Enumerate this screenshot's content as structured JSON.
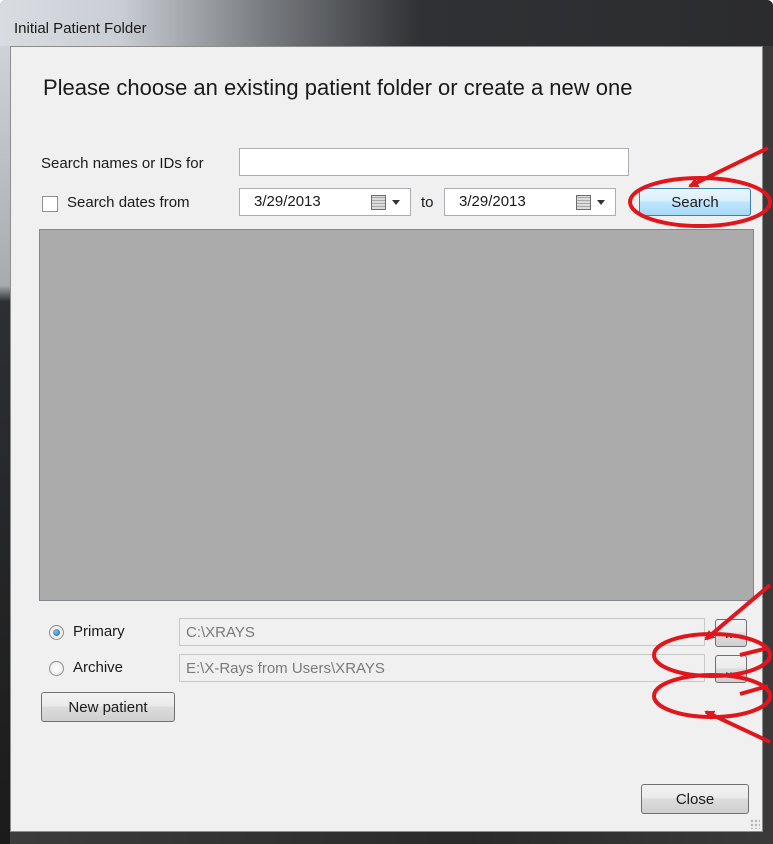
{
  "window": {
    "title": "Initial Patient Folder"
  },
  "heading": "Please choose an existing patient folder or create a new one",
  "search": {
    "names_label": "Search names or IDs for",
    "names_value": "",
    "dates_label": "Search dates from",
    "dates_checked": false,
    "date_from": "3/29/2013",
    "to_label": "to",
    "date_to": "3/29/2013",
    "search_button": "Search"
  },
  "results": {
    "rows": []
  },
  "locations": {
    "primary_label": "Primary",
    "primary_selected": true,
    "primary_path": "C:\\XRAYS",
    "archive_label": "Archive",
    "archive_selected": false,
    "archive_path": "E:\\X-Rays from Users\\XRAYS",
    "browse_label": "..."
  },
  "buttons": {
    "new_patient": "New patient",
    "close": "Close"
  },
  "colors": {
    "annotation": "#e0161c",
    "focus_border": "#3c7fb1",
    "list_background": "#ababab"
  },
  "icons": {
    "calendar": "calendar-icon",
    "dropdown": "chevron-down-icon"
  }
}
